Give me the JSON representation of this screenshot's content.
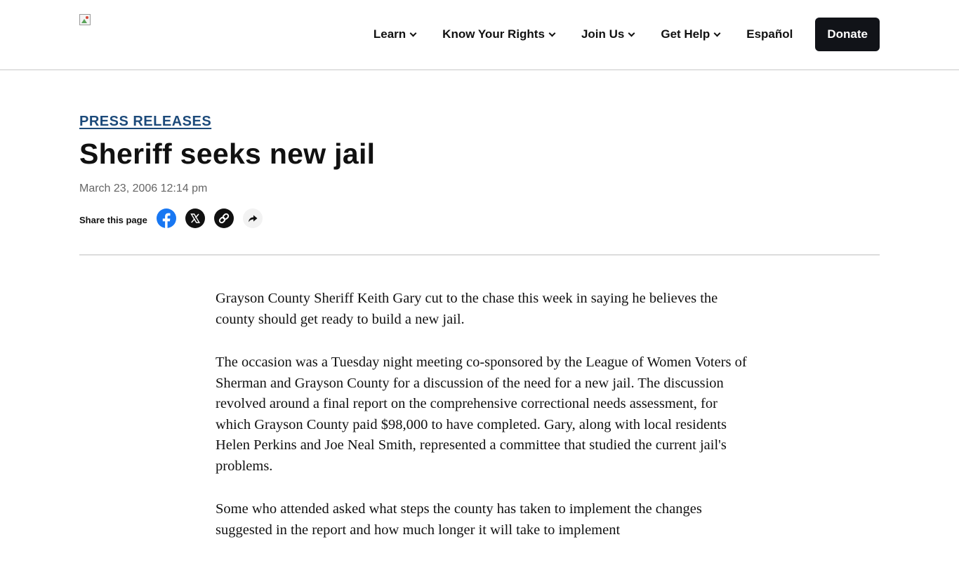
{
  "header": {
    "logo_alt": "",
    "nav": [
      {
        "label": "Learn",
        "has_dropdown": true
      },
      {
        "label": "Know Your Rights",
        "has_dropdown": true
      },
      {
        "label": "Join Us",
        "has_dropdown": true
      },
      {
        "label": "Get Help",
        "has_dropdown": true
      },
      {
        "label": "Español",
        "has_dropdown": false
      }
    ],
    "donate_label": "Donate"
  },
  "article": {
    "category": "PRESS RELEASES",
    "title": "Sheriff seeks new jail",
    "date": "March 23, 2006 12:14 pm",
    "share": {
      "label": "Share this page",
      "buttons": [
        "facebook-icon",
        "x-icon",
        "link-icon",
        "share-arrow-icon"
      ]
    },
    "paragraphs": [
      "Grayson County Sheriff Keith Gary cut to the chase this week in saying he believes the county should get ready to build a new jail.",
      "The occasion was a Tuesday night meeting co-sponsored by the League of Women Voters of Sherman and Grayson County for a discussion of the need for a new jail. The discussion revolved around a final report on the comprehensive correctional needs assessment, for which Grayson County paid $98,000 to have completed. Gary, along with local residents Helen Perkins and Joe Neal Smith, represented a committee that studied the current jail's problems.",
      "Some who attended asked what steps the county has taken to implement the changes suggested in the report and how much longer it will take to implement"
    ]
  },
  "colors": {
    "category_link": "#1c4a7a",
    "donate_bg": "#111318",
    "facebook_blue": "#1877f2",
    "meta_text": "#666666"
  }
}
